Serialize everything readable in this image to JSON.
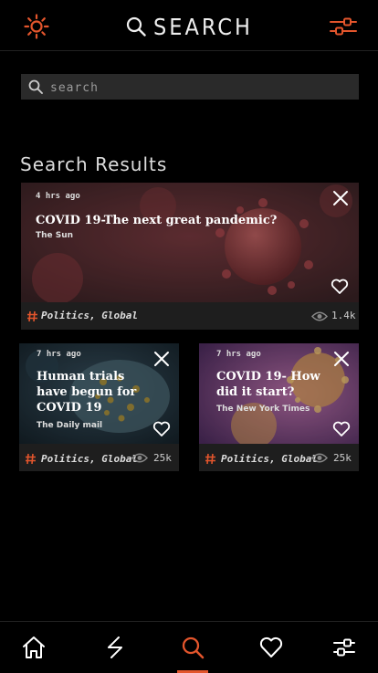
{
  "header": {
    "title": "SEARCH",
    "accent_color": "#e3552c",
    "left_icon": "sun-icon",
    "right_icon": "sliders-icon"
  },
  "search": {
    "placeholder": "search",
    "value": ""
  },
  "results": {
    "heading": "Search Results",
    "items": [
      {
        "time": "4 hrs ago",
        "title": "COVID 19-The next great pandemic?",
        "source": "The Sun",
        "categories": "Politics, Global",
        "views": "1.4k"
      },
      {
        "time": "7 hrs ago",
        "title": "Human trials have begun for COVID 19",
        "source": "The Daily mail",
        "categories": "Politics, Global",
        "views": "25k"
      },
      {
        "time": "7 hrs ago",
        "title": "COVID 19- How did it start?",
        "source": "The New York Times",
        "categories": "Politics, Global",
        "views": "25k"
      }
    ]
  },
  "nav": {
    "items": [
      "home-icon",
      "trending-icon",
      "search-icon",
      "heart-icon",
      "filter-icon"
    ],
    "active": "search-icon"
  }
}
